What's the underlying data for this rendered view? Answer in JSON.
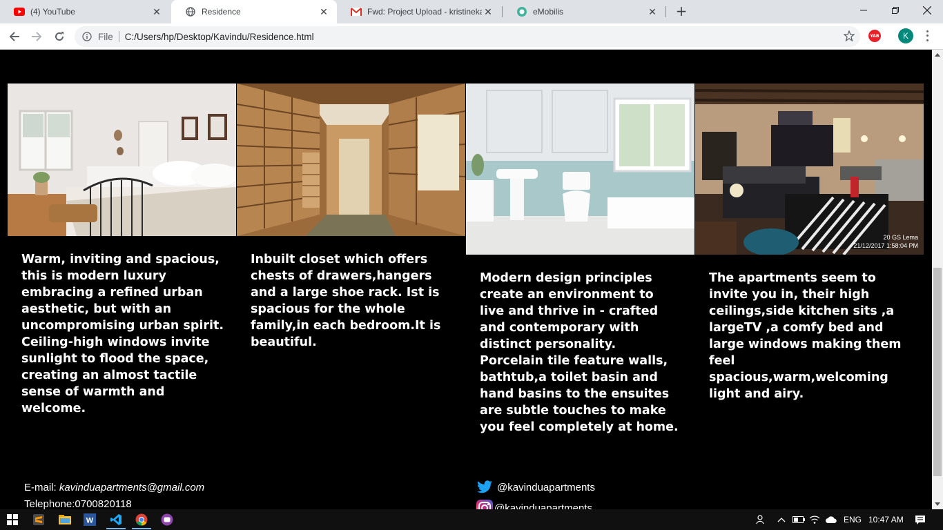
{
  "browser": {
    "tabs": [
      {
        "title": "(4) YouTube",
        "icon": "youtube-icon"
      },
      {
        "title": "Residence",
        "icon": "globe-icon",
        "active": true
      },
      {
        "title": "Fwd: Project Upload - kristinekak",
        "icon": "gmail-icon"
      },
      {
        "title": "eMobilis",
        "icon": "emobilis-icon"
      }
    ],
    "address": {
      "scheme_label": "File",
      "url": "C:/Users/hp/Desktop/Kavindu/Residence.html"
    },
    "profile_initial": "K",
    "extension_label": "YAB"
  },
  "page": {
    "rooms": [
      {
        "image": "bedroom-photo",
        "description": "Warm, inviting and spacious, this is modern luxury embracing a refined urban aesthetic, but with an uncompromising urban spirit. Ceiling-high windows invite sunlight to flood the space, creating an almost tactile sense of warmth and welcome."
      },
      {
        "image": "closet-photo",
        "description": "Inbuilt closet which offers chests of drawers,hangers and a large shoe rack. Ist is spacious for the whole family,in each bedroom.It is beautiful."
      },
      {
        "image": "bathroom-photo",
        "description": "Modern design principles create an environment to live and thrive in - crafted and contemporary with distinct personality. Porcelain tile feature walls, bathtub,a toilet basin and hand basins to the ensuites are subtle touches to make you feel completely at home."
      },
      {
        "image": "apartment-photo",
        "description": "The apartments seem to invite you in, their high ceilings,side kitchen sits ,a largeTV ,a comfy bed and large windows making them feel spacious,warm,welcoming light and airy."
      }
    ],
    "photo_stamp": {
      "line1": "20 GS Lema",
      "line2": "21/12/2017 1:58:04 PM"
    },
    "contact": {
      "email_label": "E-mail:",
      "email": "kavinduapartments@gmail.com",
      "telephone": "Telephone:0700820118"
    },
    "social": {
      "twitter": "@kavinduapartments",
      "instagram": "@kavinduapartments"
    }
  },
  "taskbar": {
    "language": "ENG",
    "time": "10:47 AM"
  },
  "colors": {
    "page_background": "#000000",
    "text": "#ffffff",
    "twitter": "#1da1f2",
    "chrome_tabbar": "#dee1e6"
  }
}
